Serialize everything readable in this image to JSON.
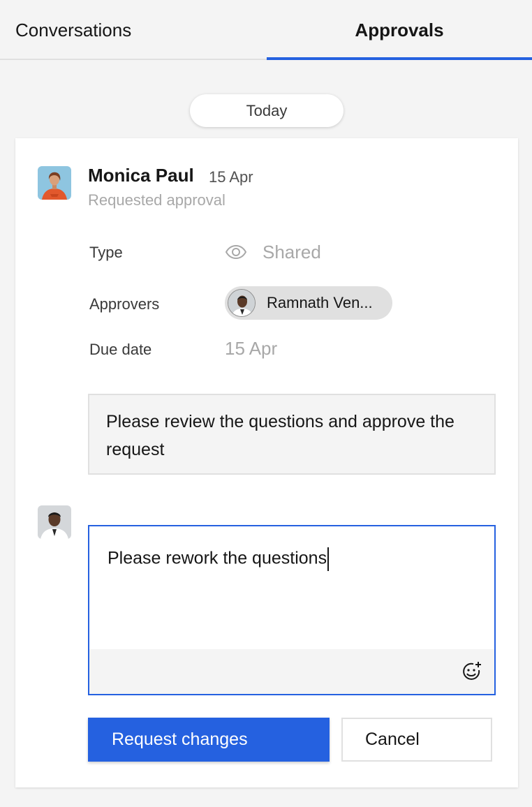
{
  "tabs": [
    {
      "label": "Conversations",
      "active": false
    },
    {
      "label": "Approvals",
      "active": true
    }
  ],
  "date_separator": "Today",
  "request": {
    "author": "Monica Paul",
    "date": "15 Apr",
    "action": "Requested approval",
    "fields": {
      "type_label": "Type",
      "type_icon": "eye-icon",
      "type_value": "Shared",
      "approvers_label": "Approvers",
      "approver_name": "Ramnath Ven...",
      "due_label": "Due date",
      "due_value": "15 Apr"
    },
    "message": "Please review the questions and approve the request"
  },
  "reply": {
    "value": "Please rework the questions",
    "emoji_icon": "add-emoji-icon"
  },
  "buttons": {
    "primary": "Request changes",
    "secondary": "Cancel"
  },
  "colors": {
    "accent": "#2561e0",
    "background": "#f4f4f4",
    "muted_text": "#a8a8a8"
  }
}
